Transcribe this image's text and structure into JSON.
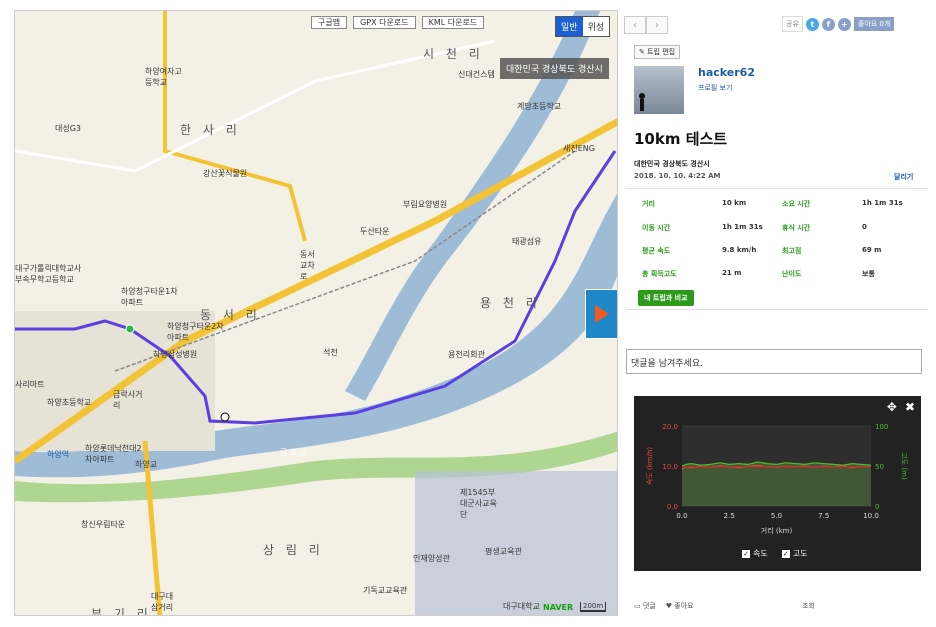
{
  "map": {
    "buttons": [
      "구글맵",
      "GPX 다운로드",
      "KML 다운로드"
    ],
    "type_normal": "일반",
    "type_satellite": "위성",
    "location_tip": "대한민국 경상북도 경산시",
    "districts": [
      "시 천 리",
      "한 사 리",
      "동 서 리",
      "용 천 리",
      "상 림 리",
      "부 기 리"
    ],
    "places": [
      "하양여자고등학교",
      "대성G3",
      "신대건스템",
      "계당초등학교",
      "새진ENG",
      "강산꽃식물원",
      "부림요양병원",
      "두산타운",
      "태광섬유",
      "대구가톨릭대학교사부속무학고등학교",
      "하양청구타운1차아파트",
      "하양청구타운2차아파트",
      "하양삼성병원",
      "석천",
      "용천리회관",
      "사리마트",
      "하양초등학교",
      "하양역",
      "하양롯데낙천대2차아파트",
      "하양교",
      "창신우림타운",
      "제1545부대군사교육단",
      "인재양성관",
      "평생교육관",
      "기독교교육관",
      "대구대학교",
      "대구대삼거리",
      "금락사거리",
      "동서교차로"
    ],
    "river": "금 호 강",
    "logo": "NAVER",
    "scale": "200m"
  },
  "panel": {
    "share_label": "공유",
    "like_label": "좋아요 0개",
    "edit_label": "트립 편집",
    "username": "hacker62",
    "profile_link": "프로필 보기",
    "title": "10km 테스트",
    "location": "대한민국 경상북도 경산시",
    "date": "2018. 10. 10. 4:22 AM",
    "activity": "달리기",
    "stats": [
      {
        "key": "거리",
        "value": "10 km"
      },
      {
        "key": "소요 시간",
        "value": "1h 1m 31s"
      },
      {
        "key": "이동 시간",
        "value": "1h 1m 31s"
      },
      {
        "key": "휴식 시간",
        "value": "0"
      },
      {
        "key": "평균 속도",
        "value": "9.8 km/h"
      },
      {
        "key": "최고점",
        "value": "69 m"
      },
      {
        "key": "총 획득고도",
        "value": "21 m"
      },
      {
        "key": "난이도",
        "value": "보통"
      }
    ],
    "compare_label": "내 트립과 비교",
    "comment_placeholder": "댓글을 남겨주세요.",
    "comment_label": "댓글",
    "like_short": "좋아요",
    "views_label": "조회"
  },
  "chart_data": {
    "type": "line",
    "xlabel": "거리 (km)",
    "ylabel_left": "속도 (km/h)",
    "ylabel_right": "고도 (m)",
    "x_ticks": [
      "0.0",
      "2.5",
      "5.0",
      "7.5",
      "10.0"
    ],
    "y_left_ticks": [
      "0.0",
      "10.0",
      "20.0"
    ],
    "y_right_ticks": [
      "0",
      "50",
      "100"
    ],
    "xlim": [
      0,
      10
    ],
    "ylim_left": [
      0,
      20
    ],
    "ylim_right": [
      0,
      100
    ],
    "x": [
      0,
      0.2,
      0.5,
      1,
      1.5,
      2,
      2.5,
      3,
      3.5,
      4,
      4.5,
      5,
      5.5,
      6,
      6.5,
      7,
      7.5,
      8,
      8.5,
      9,
      9.5,
      10
    ],
    "series": [
      {
        "name": "속도",
        "color": "#e84a3a",
        "values": [
          9.2,
          9.8,
          9.6,
          9.9,
          9.7,
          10.0,
          9.8,
          9.6,
          9.9,
          10.1,
          9.8,
          9.7,
          9.9,
          9.8,
          10.0,
          9.7,
          9.9,
          9.8,
          10.0,
          9.6,
          9.9,
          9.8
        ]
      },
      {
        "name": "고도",
        "color": "#4cc02a",
        "values": [
          50,
          52,
          53,
          51,
          52,
          54,
          52,
          53,
          52,
          55,
          53,
          52,
          54,
          53,
          52,
          54,
          53,
          52,
          51,
          53,
          52,
          51
        ]
      }
    ],
    "legend": [
      "속도",
      "고도"
    ],
    "colors": {
      "background": "#222222",
      "speed": "#e84a3a",
      "elevation": "#4cc02a",
      "ref_line": "#cc2222"
    }
  }
}
